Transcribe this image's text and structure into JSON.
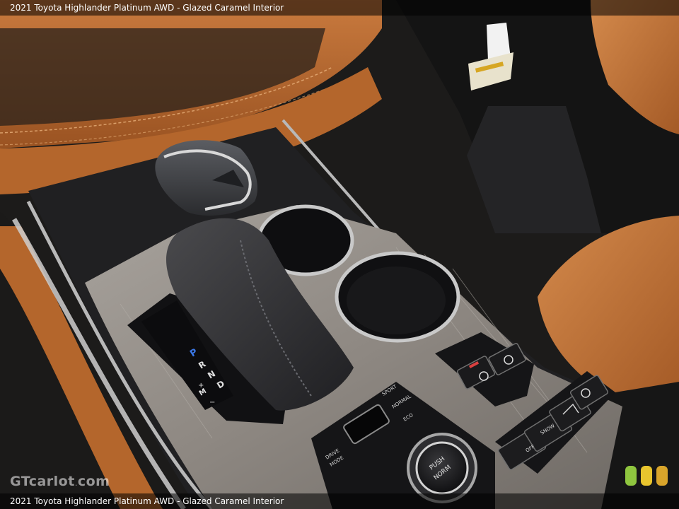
{
  "caption": {
    "top": "2021 Toyota Highlander Platinum AWD - Glazed Caramel Interior",
    "bottom": "2021 Toyota Highlander Platinum AWD - Glazed Caramel Interior"
  },
  "watermark": {
    "brand": "GTcarlot",
    "dot": ".",
    "tld": "com"
  },
  "colors": {
    "caramel_leather": "#b8692e",
    "dark_trim": "#1e1e20",
    "wood_trim": "#8f8a84",
    "chrome": "#c9c9c9",
    "indicator_blue": "#3b78e7"
  },
  "icons": {
    "size_selector": "three-color-squares-icon"
  }
}
